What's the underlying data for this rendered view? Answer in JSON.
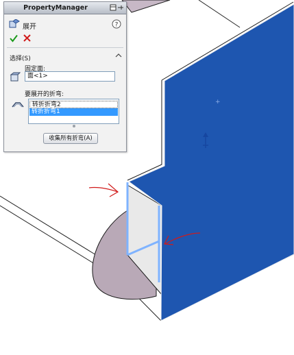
{
  "property_manager": {
    "title": "PropertyManager",
    "feature_name": "展开",
    "selections_title": "选择(S)",
    "fixed_face_label": "固定面:",
    "fixed_face_value": "面<1>",
    "bends_label": "要展开的折弯:",
    "bends": [
      "转折折弯2",
      "转折折弯1"
    ],
    "selected_bend": 1,
    "collect_bends_button": "收集所有折弯(A)"
  },
  "colors": {
    "face_blue": "#1e56b0",
    "face_gray": "#b9a9b7",
    "selection_edge": "#7fb3ff",
    "annotation_red": "#d11a1a",
    "list_highlight": "#3399ff"
  },
  "icons": [
    "unfold-feature-icon",
    "help-icon",
    "ok-check-icon",
    "cancel-x-icon",
    "collapse-chevron-icon",
    "fixed-face-icon",
    "bends-icon",
    "pin-icon",
    "origin-triad-icon"
  ]
}
